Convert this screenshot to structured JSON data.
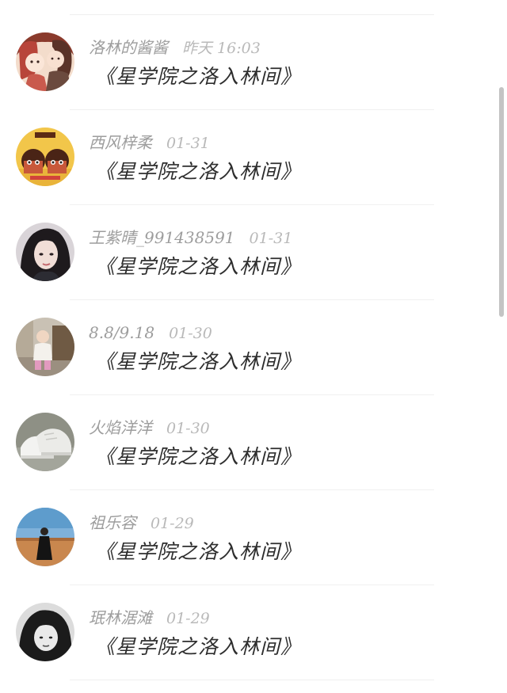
{
  "comments": [
    {
      "user": "洛林的酱酱",
      "time": "昨天 16:03",
      "text": "《星学院之洛入林间》",
      "avatar": "anime-couple-avatar"
    },
    {
      "user": "西风梓柔",
      "time": "01-31",
      "text": "《星学院之洛入林间》",
      "avatar": "double-dolls-avatar"
    },
    {
      "user": "王紫晴_991438591",
      "time": "01-31",
      "text": "《星学院之洛入林间》",
      "avatar": "girl-portrait-avatar"
    },
    {
      "user": "8.8/9.18",
      "time": "01-30",
      "text": "《星学院之洛入林间》",
      "avatar": "toddler-photo-avatar"
    },
    {
      "user": "火焰洋洋",
      "time": "01-30",
      "text": "《星学院之洛入林间》",
      "avatar": "sneakers-avatar"
    },
    {
      "user": "祖乐容",
      "time": "01-29",
      "text": "《星学院之洛入林间》",
      "avatar": "beach-figure-avatar"
    },
    {
      "user": "珉林涺滩",
      "time": "01-29",
      "text": "《星学院之洛入林间》",
      "avatar": "bw-girl-avatar"
    }
  ]
}
